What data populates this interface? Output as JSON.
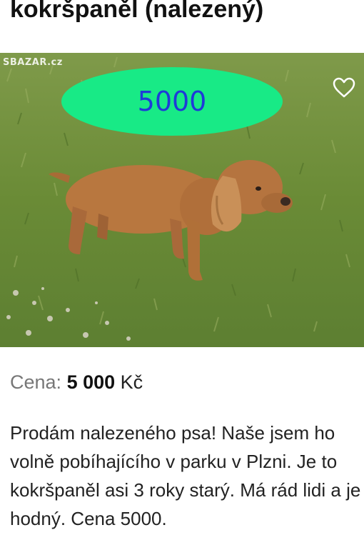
{
  "listing": {
    "title": "kokršpaněl (nalezený)",
    "watermark": "SBAZAR.cz",
    "price_badge": "5000",
    "price_label": "Cena:",
    "price_value": "5 000",
    "price_currency": "Kč",
    "description": "Prodám nalezeného psa! Naše jsem ho volně pobíhajícího v parku v Plzni. Je to kokršpaněl asi 3 roky starý. Má rád lidi a je hodný. Cena 5000."
  },
  "icons": {
    "favorite": "heart-outline-icon"
  },
  "colors": {
    "badge_fill": "#18ea86",
    "badge_text": "#1f3ad8",
    "grass": "#6f8f3a",
    "dog": "#b8773f"
  }
}
